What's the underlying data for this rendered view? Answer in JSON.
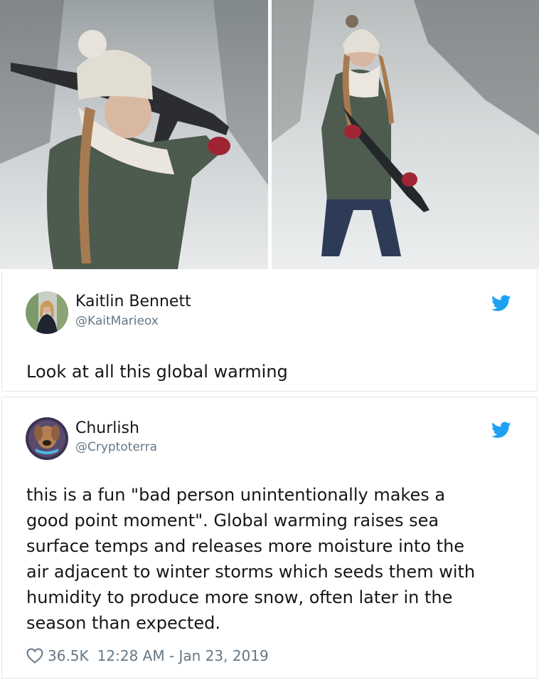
{
  "tweet1": {
    "name": "Kaitlin Bennett",
    "handle": "@KaitMarieox",
    "text": "Look at all this global warming"
  },
  "tweet2": {
    "name": "Churlish",
    "handle": "@Cryptoterra",
    "lines": [
      "this is a fun \"bad person unintentionally makes a",
      "good point moment\". Global warming raises sea",
      "surface temps and releases more moisture into the",
      "air adjacent to winter storms which seeds them with",
      "humidity to produce more snow, often later in the",
      "season than expected."
    ],
    "likes": "36.5K",
    "timestamp": "12:28 AM - Jan 23, 2019"
  },
  "icons": {
    "bird": "twitter-bird-icon",
    "heart": "heart-outline-icon"
  },
  "colors": {
    "twitter_blue": "#1da1f2",
    "text": "#14171a",
    "secondary": "#657786",
    "border": "#e1e8ed"
  }
}
